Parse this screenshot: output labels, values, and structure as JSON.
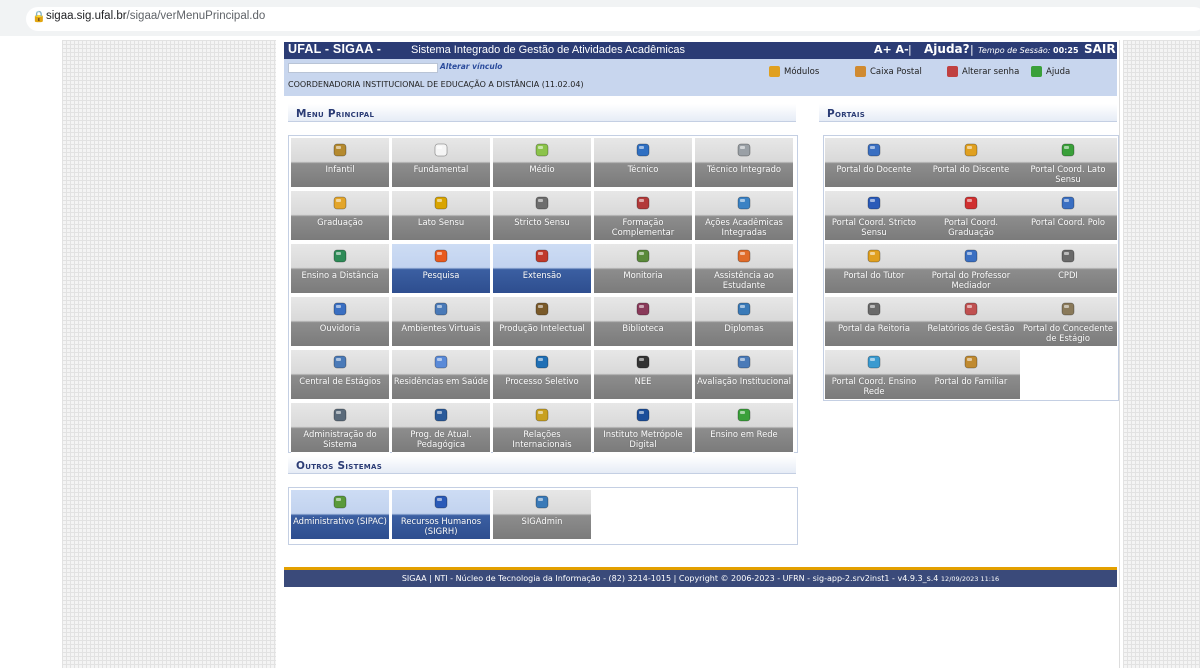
{
  "browser": {
    "url_domain": "sigaa.sig.ufal.br",
    "url_path": "/sigaa/verMenuPrincipal.do"
  },
  "header": {
    "brand": "UFAL - SIGAA -",
    "subtitle": "Sistema Integrado de Gestão de Atividades Acadêmicas",
    "font_controls": "A+ A-",
    "help": "Ajuda?",
    "session_label": "Tempo de Sessão:",
    "session_time": "00:25",
    "logout": "SAIR"
  },
  "info": {
    "change_link": "Alterar vínculo",
    "unit": "COORDENADORIA INSTITUCIONAL DE EDUCAÇÃO A DISTÂNCIA (11.02.04)",
    "tools": [
      {
        "label": "Módulos",
        "icon": "modules-icon",
        "color": "#e0a020"
      },
      {
        "label": "Caixa Postal",
        "icon": "mailbox-icon",
        "color": "#d08a30"
      },
      {
        "label": "Alterar senha",
        "icon": "key-icon",
        "color": "#c04040"
      },
      {
        "label": "Ajuda",
        "icon": "help-icon",
        "color": "#3aa03a"
      }
    ]
  },
  "menu": {
    "title": "Menu Principal",
    "tiles": [
      {
        "label": "Infantil",
        "icon": "infantil-icon",
        "color": "#b58a2f",
        "active": false
      },
      {
        "label": "Fundamental",
        "icon": "notebook-icon",
        "color": "#f5f5f5",
        "active": false
      },
      {
        "label": "Médio",
        "icon": "pencil-icon",
        "color": "#8bc34a",
        "active": false
      },
      {
        "label": "Técnico",
        "icon": "book-icon",
        "color": "#2f6fc2",
        "active": false
      },
      {
        "label": "Técnico Integrado",
        "icon": "certificate-icon",
        "color": "#9aa0a6",
        "active": false
      },
      {
        "label": "Graduação",
        "icon": "books-stack-icon",
        "color": "#e3a52a",
        "active": false
      },
      {
        "label": "Lato Sensu",
        "icon": "yellow-book-icon",
        "color": "#d9a400",
        "active": false
      },
      {
        "label": "Stricto Sensu",
        "icon": "dark-book-icon",
        "color": "#6d6d6d",
        "active": false
      },
      {
        "label": "Formação Complementar",
        "icon": "red-book-icon",
        "color": "#b23a3a",
        "active": false
      },
      {
        "label": "Ações Acadêmicas Integradas",
        "icon": "puzzle-icon",
        "color": "#3b82c4",
        "active": false
      },
      {
        "label": "Ensino a Distância",
        "icon": "globe-icon",
        "color": "#2e8b57",
        "active": false
      },
      {
        "label": "Pesquisa",
        "icon": "flask-icon",
        "color": "#e85a1e",
        "active": true
      },
      {
        "label": "Extensão",
        "icon": "box-icon",
        "color": "#c0392b",
        "active": true
      },
      {
        "label": "Monitoria",
        "icon": "presentation-icon",
        "color": "#5a8a3a",
        "active": false
      },
      {
        "label": "Assistência ao Estudante",
        "icon": "user-help-icon",
        "color": "#e06c2a",
        "active": false
      },
      {
        "label": "Ouvidoria",
        "icon": "ouvidoria-user-icon",
        "color": "#3a6fc2",
        "active": false
      },
      {
        "label": "Ambientes Virtuais",
        "icon": "virtual-users-icon",
        "color": "#4a7ab8",
        "active": false
      },
      {
        "label": "Produção Intelectual",
        "icon": "user-check-icon",
        "color": "#7a5a2a",
        "active": false
      },
      {
        "label": "Biblioteca",
        "icon": "library-icon",
        "color": "#8a3a5a",
        "active": false
      },
      {
        "label": "Diplomas",
        "icon": "diploma-icon",
        "color": "#3a7ab8",
        "active": false
      },
      {
        "label": "Central de Estágios",
        "icon": "id-card-icon",
        "color": "#4a7ab8",
        "active": false
      },
      {
        "label": "Residências em Saúde",
        "icon": "doctor-icon",
        "color": "#5a8ad8",
        "active": false
      },
      {
        "label": "Processo Seletivo",
        "icon": "process-icon",
        "color": "#1f6fb5",
        "active": false
      },
      {
        "label": "NEE",
        "icon": "accessibility-icon",
        "color": "#333333",
        "active": false
      },
      {
        "label": "Avaliação Institucional",
        "icon": "evaluation-icon",
        "color": "#4a7ab8",
        "active": false
      },
      {
        "label": "Administração do Sistema",
        "icon": "settings-icon",
        "color": "#5a6a7a",
        "active": false
      },
      {
        "label": "Prog. de Atual. Pedagógica",
        "icon": "monitor-icon",
        "color": "#2a5a9a",
        "active": false
      },
      {
        "label": "Relações Internacionais",
        "icon": "globe-arrows-icon",
        "color": "#c8a020",
        "active": false
      },
      {
        "label": "Instituto Metrópole Digital",
        "icon": "imd-logo-icon",
        "color": "#1c4e9a",
        "active": false
      },
      {
        "label": "Ensino em Rede",
        "icon": "network-icon",
        "color": "#3aa03a",
        "active": false
      }
    ]
  },
  "portais": {
    "title": "Portais",
    "tiles": [
      {
        "label": "Portal do Docente",
        "icon": "docente-icon",
        "color": "#3a6fc2"
      },
      {
        "label": "Portal do Discente",
        "icon": "discente-icon",
        "color": "#e0a020"
      },
      {
        "label": "Portal Coord. Lato Sensu",
        "icon": "coord-lato-icon",
        "color": "#3aa03a"
      },
      {
        "label": "Portal Coord. Stricto Sensu",
        "icon": "coord-stricto-icon",
        "color": "#2a5ab8"
      },
      {
        "label": "Portal Coord. Graduação",
        "icon": "coord-graduacao-icon",
        "color": "#d03030"
      },
      {
        "label": "Portal Coord. Polo",
        "icon": "coord-polo-icon",
        "color": "#3a6fc2"
      },
      {
        "label": "Portal do Tutor",
        "icon": "tutor-icon",
        "color": "#e0a020"
      },
      {
        "label": "Portal do Professor Mediador",
        "icon": "professor-mediador-icon",
        "color": "#3a6fc2"
      },
      {
        "label": "CPDI",
        "icon": "cpdi-icon",
        "color": "#6a6a6a"
      },
      {
        "label": "Portal da Reitoria",
        "icon": "reitoria-icon",
        "color": "#6a6a6a"
      },
      {
        "label": "Relatórios de Gestão",
        "icon": "reports-icon",
        "color": "#c05050"
      },
      {
        "label": "Portal do Concedente de Estágio",
        "icon": "concedente-icon",
        "color": "#8a7a5a"
      },
      {
        "label": "Portal Coord. Ensino Rede",
        "icon": "ensino-rede-icon",
        "color": "#3a9ad0"
      },
      {
        "label": "Portal do Familiar",
        "icon": "familiar-icon",
        "color": "#c08a30"
      }
    ]
  },
  "outros": {
    "title": "Outros Sistemas",
    "tiles": [
      {
        "label": "Administrativo (SIPAC)",
        "icon": "sipac-icon",
        "color": "#5a9a3a",
        "active": true
      },
      {
        "label": "Recursos Humanos (SIGRH)",
        "icon": "sigrh-icon",
        "color": "#2a5ab8",
        "active": true
      },
      {
        "label": "SIGAdmin",
        "icon": "sigadmin-icon",
        "color": "#3a7ab8",
        "active": false
      }
    ]
  },
  "footer": {
    "text": "SIGAA | NTI - Núcleo de Tecnologia da Informação - (82) 3214-1015 | Copyright © 2006-2023 - UFRN - sig-app-2.srv2inst1 - v4.9.3_s.4",
    "date": "12/09/2023 11:16"
  }
}
